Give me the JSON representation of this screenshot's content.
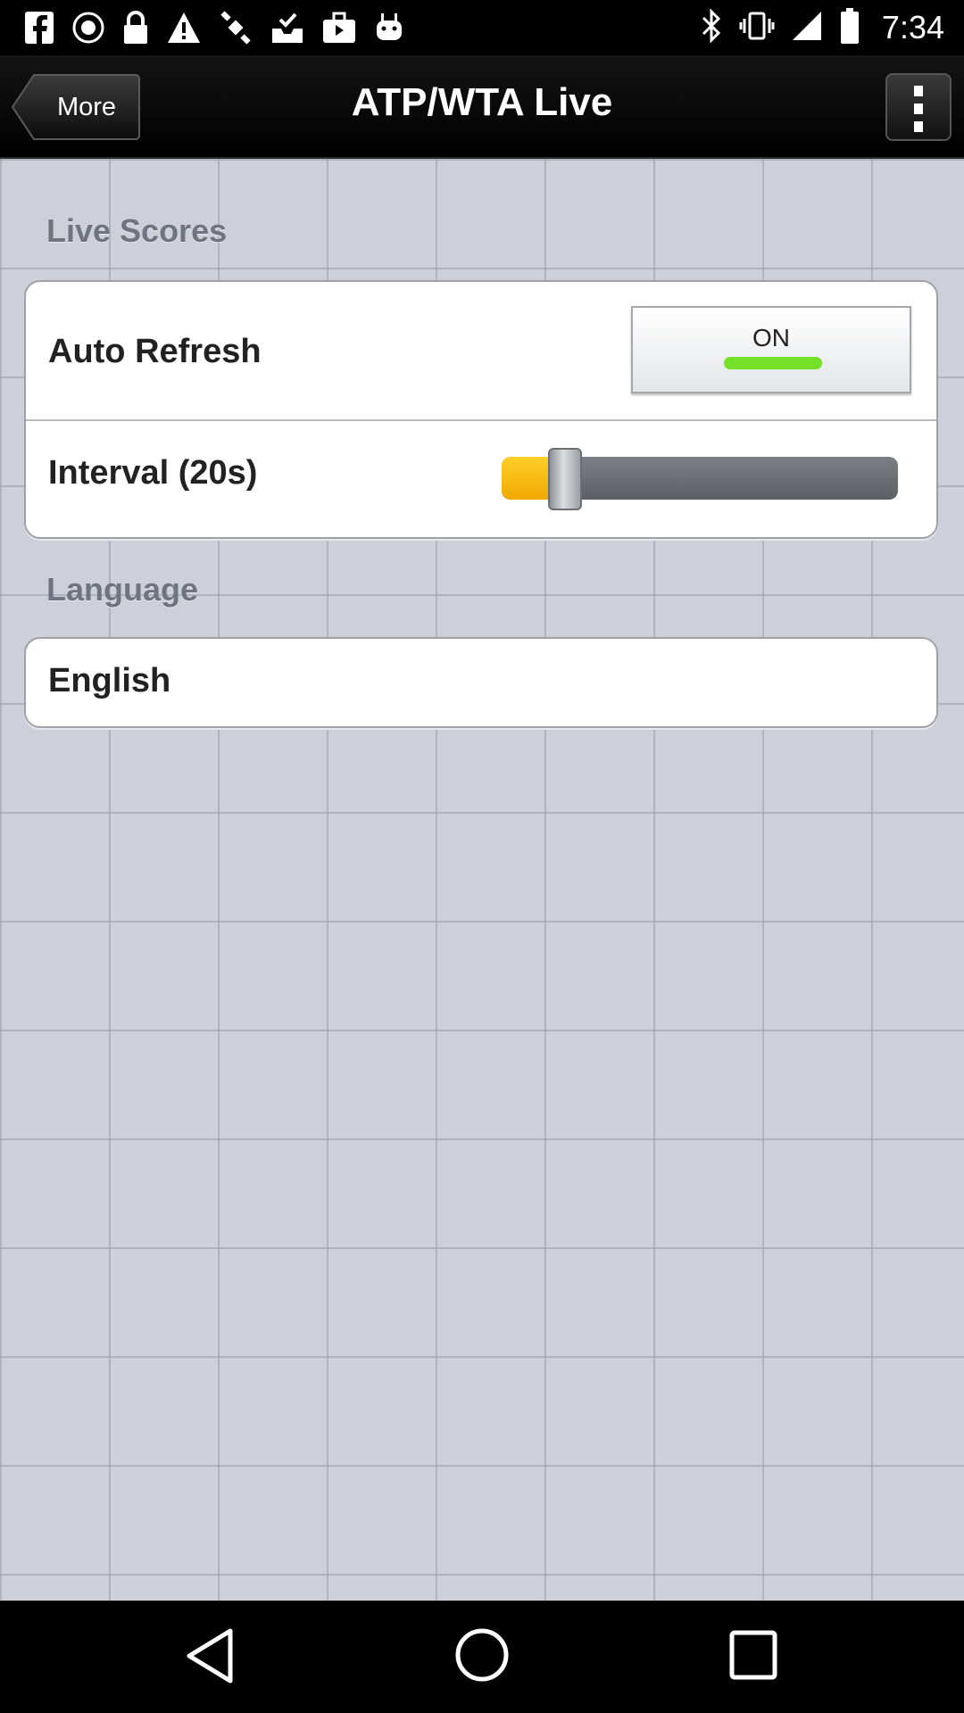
{
  "status_bar": {
    "time": "7:34",
    "left_icons": [
      "facebook-icon",
      "record-icon",
      "lock-icon",
      "warning-icon",
      "satellite-icon",
      "check-tray-icon",
      "briefcase-icon",
      "android-icon"
    ],
    "right_icons": [
      "bluetooth-icon",
      "vibrate-icon",
      "signal-icon",
      "battery-icon"
    ]
  },
  "header": {
    "back_label": "More",
    "title": "ATP/WTA Live",
    "menu_icon": "overflow-menu-icon"
  },
  "sections": {
    "live_scores": {
      "title": "Live Scores",
      "auto_refresh_label": "Auto Refresh",
      "auto_refresh_state": "ON",
      "interval_label": "Interval (20s)",
      "interval_slider_fraction": 0.08
    },
    "language": {
      "title": "Language",
      "value": "English"
    }
  },
  "colors": {
    "toggle_on": "#74e027",
    "slider_fill": "#ffc21a",
    "background": "#cdd0d8"
  },
  "nav_bar": {
    "icons": [
      "back-triangle-icon",
      "home-circle-icon",
      "recents-square-icon"
    ]
  }
}
